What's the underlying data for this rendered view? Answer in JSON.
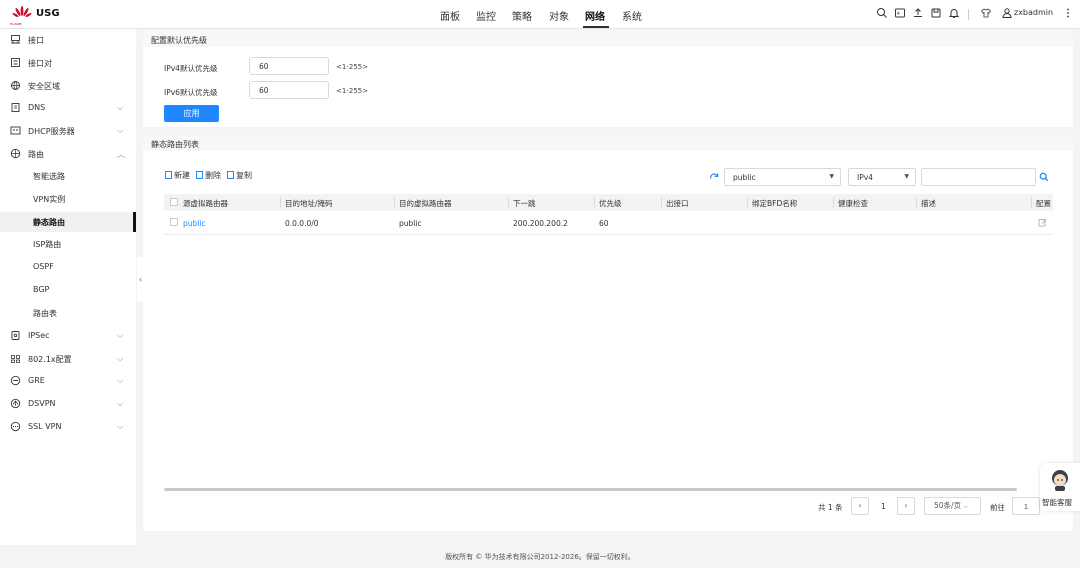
{
  "header": {
    "brand": "USG",
    "vendor": "HUAWEI",
    "nav": [
      "面板",
      "监控",
      "策略",
      "对象",
      "网络",
      "系统"
    ],
    "active_nav": "网络",
    "user": "zxbadmin"
  },
  "sidebar": {
    "items": [
      {
        "label": "接口",
        "icon": "interface-icon"
      },
      {
        "label": "接口对",
        "icon": "interface-pair-icon"
      },
      {
        "label": "安全区域",
        "icon": "security-zone-icon"
      },
      {
        "label": "DNS",
        "icon": "dns-icon",
        "expandable": true
      },
      {
        "label": "DHCP服务器",
        "icon": "dhcp-server-icon",
        "expandable": true
      },
      {
        "label": "路由",
        "icon": "route-icon",
        "expanded": true
      },
      {
        "label": "智能选路"
      },
      {
        "label": "VPN实例"
      },
      {
        "label": "静态路由",
        "active": true
      },
      {
        "label": "ISP路由"
      },
      {
        "label": "OSPF"
      },
      {
        "label": "BGP"
      },
      {
        "label": "路由表"
      },
      {
        "label": "IPSec",
        "icon": "ipsec-icon",
        "expandable": true
      },
      {
        "label": "802.1x配置",
        "icon": "dot1x-icon",
        "expandable": true
      },
      {
        "label": "GRE",
        "icon": "gre-icon",
        "expandable": true
      },
      {
        "label": "DSVPN",
        "icon": "dsvpn-icon",
        "expandable": true
      },
      {
        "label": "SSL VPN",
        "icon": "sslvpn-icon",
        "expandable": true
      }
    ]
  },
  "priority_config": {
    "title": "配置默认优先级",
    "ipv4_label": "IPv4默认优先级",
    "ipv4_value": "60",
    "ipv6_label": "IPv6默认优先级",
    "ipv6_value": "60",
    "range_hint": "<1-255>",
    "apply_label": "应用"
  },
  "route_list": {
    "title": "静态路由列表",
    "toolbar": {
      "new": "新建",
      "delete": "删除",
      "copy": "复制"
    },
    "vrf_select": "public",
    "ip_version_select": "IPv4",
    "search_value": "",
    "columns": [
      "源虚拟路由器",
      "目的地址/掩码",
      "目的虚拟路由器",
      "下一跳",
      "优先级",
      "出接口",
      "绑定BFD名称",
      "健康检查",
      "描述",
      "配置"
    ],
    "rows": [
      {
        "source_vrf": "public",
        "dest": "0.0.0.0/0",
        "dest_vrf": "public",
        "next_hop": "200.200.200.2",
        "priority": "60",
        "out_if": "",
        "bfd": "",
        "health": "",
        "desc": ""
      }
    ]
  },
  "pagination": {
    "total": "共 1 条",
    "current_page": "1",
    "page_size": "50条/页",
    "goto_label": "前往",
    "goto_value": "1"
  },
  "assistant": {
    "label": "智能客服"
  },
  "footer": {
    "copyright": "版权所有 © 华为技术有限公司2012-2026。保留一切权利。"
  },
  "colors": {
    "accent": "#1e88ff",
    "brand_red": "#cf0a2c"
  }
}
